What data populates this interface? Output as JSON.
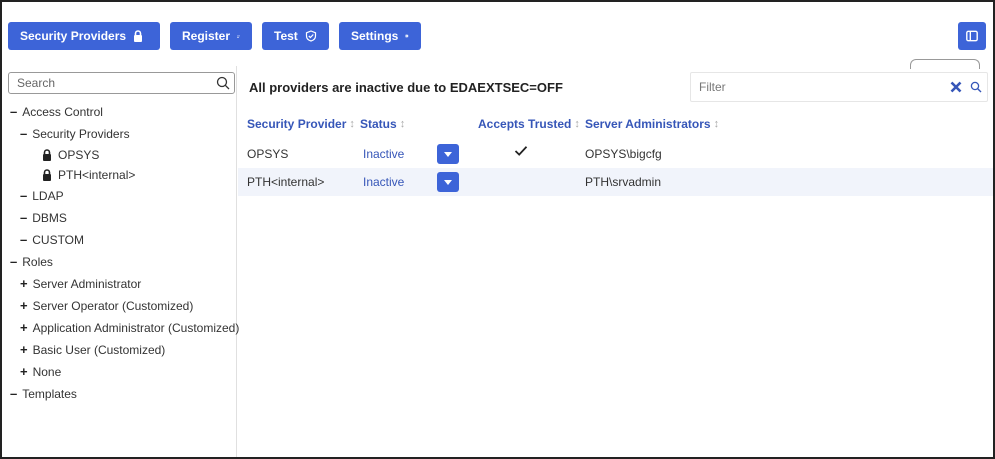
{
  "toolbar": {
    "buttons": [
      {
        "label": "Security Providers",
        "icon": "lock-icon"
      },
      {
        "label": "Register",
        "icon": "add-user-icon"
      },
      {
        "label": "Test",
        "icon": "shield-check-icon"
      },
      {
        "label": "Settings",
        "icon": "gear-icon"
      }
    ],
    "panel_icon": "panel-toggle-icon",
    "accent": "#3d64d8"
  },
  "sidebar": {
    "search_placeholder": "Search",
    "tree": [
      {
        "sign": "–",
        "label": "Access Control"
      },
      {
        "sign": "–",
        "label": "Security Providers"
      },
      {
        "icon": "lock-icon",
        "label": "OPSYS"
      },
      {
        "icon": "lock-icon",
        "label": "PTH<internal>"
      },
      {
        "sign": "–",
        "label": "LDAP"
      },
      {
        "sign": "–",
        "label": "DBMS"
      },
      {
        "sign": "–",
        "label": "CUSTOM"
      },
      {
        "sign": "–",
        "label": "Roles"
      },
      {
        "sign": "+",
        "label": "Server Administrator"
      },
      {
        "sign": "+",
        "label": "Server Operator (Customized)"
      },
      {
        "sign": "+",
        "label": "Application Administrator (Customized)"
      },
      {
        "sign": "+",
        "label": "Basic User (Customized)"
      },
      {
        "sign": "+",
        "label": "None"
      },
      {
        "sign": "–",
        "label": "Templates"
      }
    ]
  },
  "main": {
    "title": "All providers are inactive due to EDAEXTSEC=OFF",
    "filter_placeholder": "Filter",
    "table": {
      "headers": [
        "Security Provider",
        "Status",
        "Accepts Trusted",
        "Server Administrators"
      ],
      "rows": [
        {
          "provider": "OPSYS",
          "status": "Inactive",
          "accepts_trusted": true,
          "admins": "OPSYS\\bigcfg"
        },
        {
          "provider": "PTH<internal>",
          "status": "Inactive",
          "accepts_trusted": false,
          "admins": "PTH\\srvadmin"
        }
      ]
    }
  }
}
